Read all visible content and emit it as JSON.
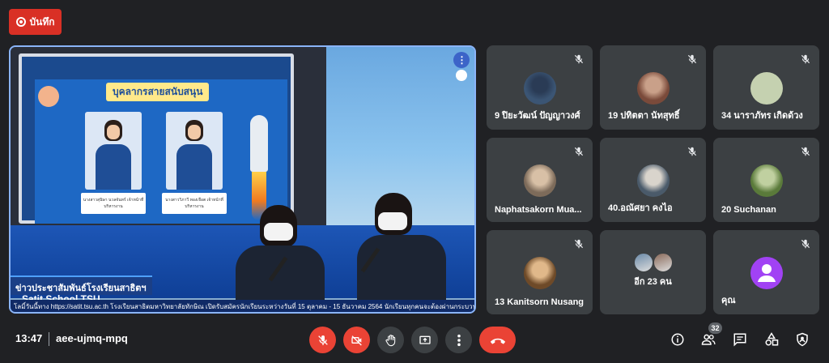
{
  "recording": {
    "label": "บันทึก",
    "color": "#d93025"
  },
  "presentation": {
    "slide_title": "บุคลากรสายสนับสนุน",
    "card_captions": [
      "นางสาวสุนิษา นวลจันทร์\nเจ้าหน้าที่บริหารงาน",
      "นางสาววิภาวี ทองเจือต\nเจ้าหน้าที่บริหารงาน"
    ],
    "lower_third": "ข่าวประชาสัมพันธ์โรงเรียนสาธิตฯ",
    "school_label": "Satit School TSU",
    "ticker": "โลมิ์วันนี้ทาง https://satit.tsu.ac.th  โรงเรียนสาธิตมหาวิทยาลัยทักษิณ เปิดรับสมัครนักเรียนระหว่างวันที่ 15 ตุลาคม - 15 ธันวาคม 2564  นักเรียนทุกคนจะต้องผ่านกระบวนการสอบคัด",
    "menu_icon": "more-vert-icon",
    "border_color": "#8ab4f8"
  },
  "participants": [
    {
      "name": "9 ปิยะวัฒน์ ปัญญาวงศ์",
      "avatar": "photo"
    },
    {
      "name": "19 ปทิตตา นัทสุทธิ์",
      "avatar": "photo"
    },
    {
      "name": "34 นาราภัทร เกิดด้วง",
      "avatar": "plain",
      "avatar_color": "#c5d1b0"
    },
    {
      "name": "Naphatsakorn Mua...",
      "avatar": "photo"
    },
    {
      "name": "40.อณัศยา คงไอ",
      "avatar": "photo"
    },
    {
      "name": "20 Suchanan",
      "avatar": "photo"
    },
    {
      "name": "13 Kanitsorn Nusang",
      "avatar": "photo"
    },
    {
      "name": "อีก 23 คน",
      "avatar": "group"
    },
    {
      "name": "คุณ",
      "avatar": "person-icon",
      "avatar_color": "#a142f4"
    }
  ],
  "bottom_bar": {
    "time": "13:47",
    "meeting_code": "aee-ujmq-mpq",
    "participant_count": "32",
    "controls": [
      "mic-off-icon",
      "camera-off-icon",
      "raise-hand-icon",
      "present-icon",
      "more-options-icon",
      "end-call-icon"
    ],
    "right_icons": [
      "info-icon",
      "people-icon",
      "chat-icon",
      "activities-icon",
      "host-controls-icon"
    ]
  }
}
